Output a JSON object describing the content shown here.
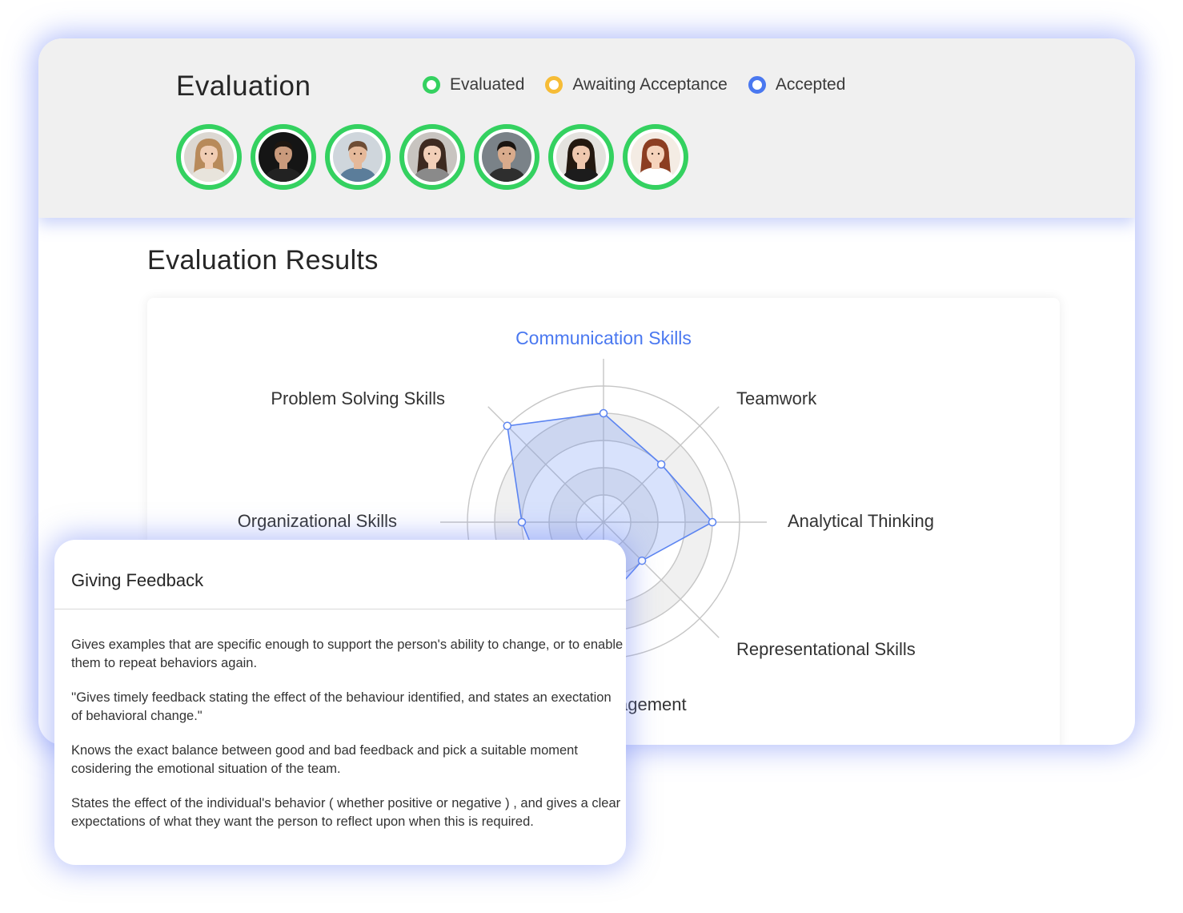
{
  "header": {
    "title": "Evaluation",
    "legend": [
      {
        "label": "Evaluated",
        "color": "#34d160"
      },
      {
        "label": "Awaiting Acceptance",
        "color": "#f6bc36"
      },
      {
        "label": "Accepted",
        "color": "#4a78f0"
      }
    ],
    "avatars": [
      {
        "status": "Evaluated",
        "bg": "#dcd8d2",
        "skin": "#f0cdb4",
        "hair": "#b88a5a",
        "shirt": "#e8e4dc",
        "hair_style": "long"
      },
      {
        "status": "Evaluated",
        "bg": "#151515",
        "skin": "#c99a7c",
        "hair": "#1e1610",
        "shirt": "#222222",
        "hair_style": "short"
      },
      {
        "status": "Evaluated",
        "bg": "#cfd6dc",
        "skin": "#e5b99a",
        "hair": "#6e4d35",
        "shirt": "#5b7d9a",
        "hair_style": "short"
      },
      {
        "status": "Evaluated",
        "bg": "#c8c4c0",
        "skin": "#f2cfb8",
        "hair": "#3e2a20",
        "shirt": "#8a8a8a",
        "hair_style": "long"
      },
      {
        "status": "Evaluated",
        "bg": "#7a8288",
        "skin": "#d9ab8c",
        "hair": "#1a1410",
        "shirt": "#2e2e2e",
        "hair_style": "short"
      },
      {
        "status": "Evaluated",
        "bg": "#e4e2de",
        "skin": "#efc7ae",
        "hair": "#24180f",
        "shirt": "#1c1c1c",
        "hair_style": "long"
      },
      {
        "status": "Evaluated",
        "bg": "#f4ece4",
        "skin": "#f5d3bc",
        "hair": "#8c3e22",
        "shirt": "#ffffff",
        "hair_style": "long"
      }
    ]
  },
  "results": {
    "title": "Evaluation Results"
  },
  "chart_data": {
    "type": "radar",
    "axes": [
      "Communication Skills",
      "Teamwork",
      "Analytical Thinking",
      "Representational Skills",
      "Management",
      "Giving Feedback",
      "Organizational Skills",
      "Problem Solving Skills"
    ],
    "visible_labels": [
      "Communication Skills",
      "Teamwork",
      "Analytical Thinking",
      "Representational Skills",
      "agement",
      "",
      "Organizational Skills",
      "Problem Solving Skills"
    ],
    "highlighted_axis": "Communication Skills",
    "rings": 5,
    "max": 5,
    "series": [
      {
        "values": [
          4,
          3,
          4,
          2,
          3,
          3,
          3,
          5
        ]
      }
    ],
    "grid": true,
    "colors": {
      "highlight": "#4a78f0",
      "line": "#5b84f1",
      "fill": "#5b84f1",
      "ring": "#c6c6c6",
      "band": "#f0f0f0",
      "label": "#333333"
    }
  },
  "feedback": {
    "title": "Giving Feedback",
    "paragraphs": [
      "Gives examples that are specific enough to support the person's ability to change, or to enable them to repeat behaviors again.",
      "''Gives timely feedback stating the effect of the behaviour identified, and states an exectation of behavioral change.\"",
      "Knows the exact balance between good and bad feedback and pick a suitable moment cosidering the emotional situation of the team.",
      "States the effect of the individual's behavior ( whether positive or negative ) , and gives a  clear expectations of what they want the person to reflect upon when this is required."
    ]
  }
}
